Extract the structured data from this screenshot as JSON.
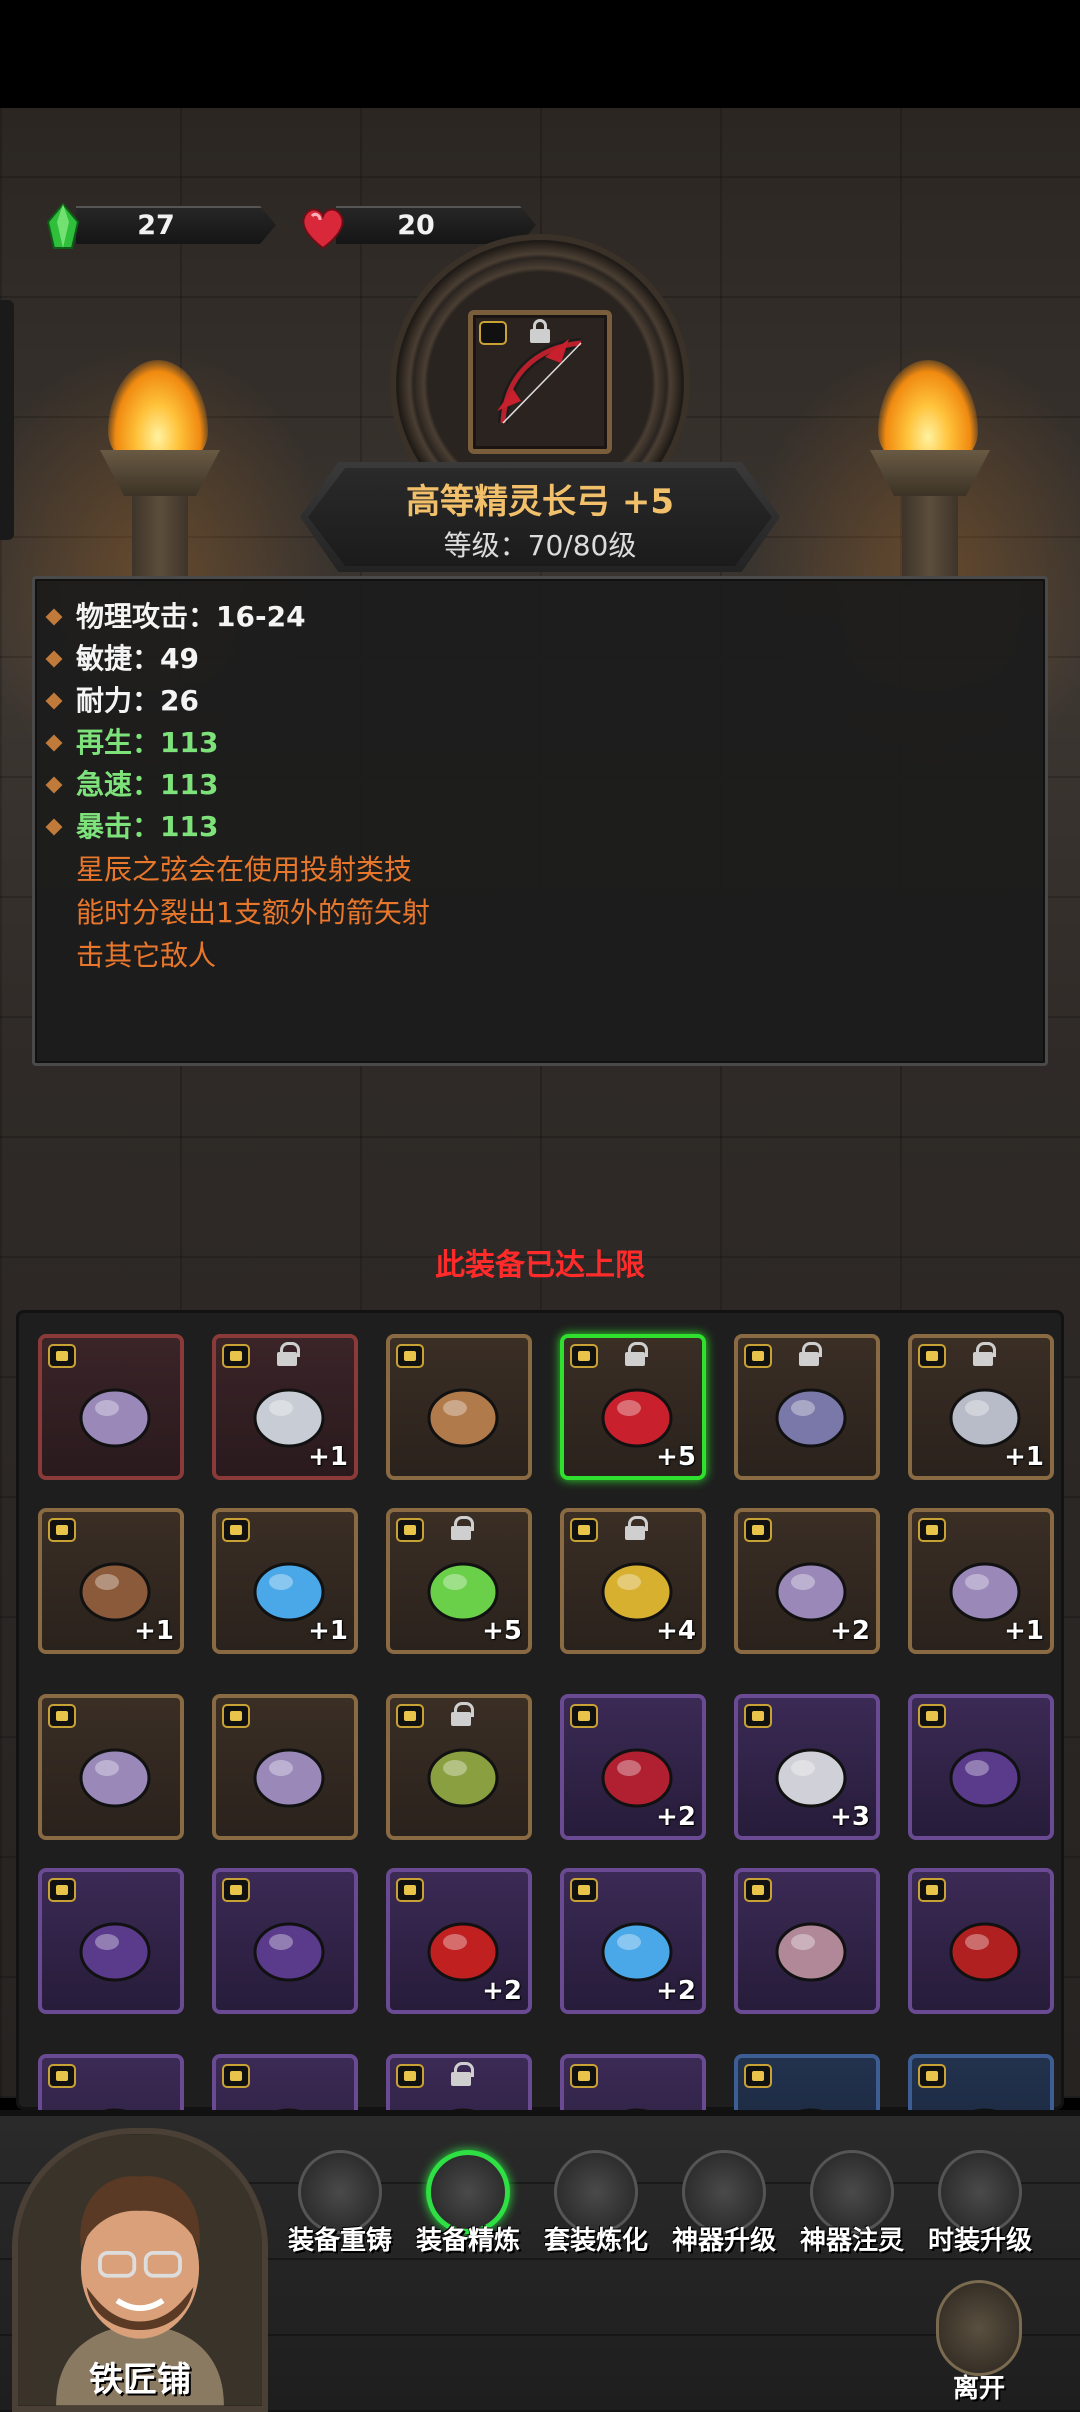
{
  "resources": [
    {
      "icon": "green-crystal-icon",
      "value": "27"
    },
    {
      "icon": "red-heart-gem-icon",
      "value": "20"
    }
  ],
  "item": {
    "name": "高等精灵长弓 +5",
    "level": "等级：70/80级",
    "icon": "elven-longbow-icon"
  },
  "stats": [
    {
      "text": "物理攻击：16-24",
      "color": "white"
    },
    {
      "text": "敏捷：49",
      "color": "white"
    },
    {
      "text": "耐力：26",
      "color": "white"
    },
    {
      "text": "再生：113",
      "color": "green"
    },
    {
      "text": "急速：113",
      "color": "green"
    },
    {
      "text": "暴击：113",
      "color": "green"
    }
  ],
  "description_lines": [
    "星辰之弦会在使用投射类技",
    "能时分裂出1支额外的箭矢射",
    "击其它敌人"
  ],
  "notice": "此装备已达上限",
  "inventory": [
    {
      "icon": "purple-shorts-icon",
      "frame": "red",
      "locked": false,
      "plus": ""
    },
    {
      "icon": "silver-greaves-icon",
      "frame": "red",
      "locked": true,
      "plus": "+1"
    },
    {
      "icon": "wooden-staff-icon",
      "frame": "bronze",
      "locked": false,
      "plus": ""
    },
    {
      "icon": "elven-longbow-icon",
      "frame": "selected",
      "locked": true,
      "plus": "+5"
    },
    {
      "icon": "war-hammer-icon",
      "frame": "bronze",
      "locked": true,
      "plus": ""
    },
    {
      "icon": "plate-armor-icon",
      "frame": "bronze",
      "locked": true,
      "plus": "+1"
    },
    {
      "icon": "feathered-hat-icon",
      "frame": "bronze",
      "locked": false,
      "plus": "+1"
    },
    {
      "icon": "blue-potion-necklace-icon",
      "frame": "bronze",
      "locked": false,
      "plus": "+1"
    },
    {
      "icon": "emerald-ring-icon",
      "frame": "bronze",
      "locked": true,
      "plus": "+5"
    },
    {
      "icon": "golden-eye-ring-icon",
      "frame": "bronze",
      "locked": true,
      "plus": "+4"
    },
    {
      "icon": "purple-shorts-icon",
      "frame": "bronze",
      "locked": false,
      "plus": "+2"
    },
    {
      "icon": "purple-boots-icon",
      "frame": "bronze",
      "locked": false,
      "plus": "+1"
    },
    {
      "icon": "purple-boots-icon",
      "frame": "bronze",
      "locked": false,
      "plus": ""
    },
    {
      "icon": "purple-boots-icon",
      "frame": "bronze",
      "locked": false,
      "plus": ""
    },
    {
      "icon": "green-boots-icon",
      "frame": "bronze",
      "locked": true,
      "plus": ""
    },
    {
      "icon": "red-coat-icon",
      "frame": "purple",
      "locked": false,
      "plus": "+2"
    },
    {
      "icon": "fur-armor-icon",
      "frame": "purple",
      "locked": false,
      "plus": "+3"
    },
    {
      "icon": "wizard-hat-icon",
      "frame": "purple",
      "locked": false,
      "plus": ""
    },
    {
      "icon": "wizard-hat-icon",
      "frame": "purple",
      "locked": false,
      "plus": ""
    },
    {
      "icon": "wizard-hat-icon",
      "frame": "purple",
      "locked": false,
      "plus": ""
    },
    {
      "icon": "plumed-helmet-icon",
      "frame": "purple",
      "locked": false,
      "plus": "+2"
    },
    {
      "icon": "blue-potion-necklace-icon",
      "frame": "purple",
      "locked": false,
      "plus": "+2"
    },
    {
      "icon": "pink-bracer-icon",
      "frame": "purple",
      "locked": false,
      "plus": ""
    },
    {
      "icon": "red-gauntlet-icon",
      "frame": "purple",
      "locked": false,
      "plus": ""
    },
    {
      "icon": "purple-helmet-icon",
      "frame": "purple",
      "locked": false,
      "plus": ""
    },
    {
      "icon": "butterfly-necklace-icon",
      "frame": "purple",
      "locked": false,
      "plus": ""
    },
    {
      "icon": "silver-helm-icon",
      "frame": "purple",
      "locked": true,
      "plus": ""
    },
    {
      "icon": "purple-cloth-icon",
      "frame": "purple",
      "locked": false,
      "plus": ""
    },
    {
      "icon": "silver-gauntlet-icon",
      "frame": "blue",
      "locked": false,
      "plus": ""
    },
    {
      "icon": "silver-gauntlet-icon",
      "frame": "blue",
      "locked": false,
      "plus": ""
    }
  ],
  "menu": [
    {
      "label": "装备重铸",
      "icon": "helmet-reforge-icon",
      "active": false
    },
    {
      "label": "装备精炼",
      "icon": "refine-icon",
      "active": true
    },
    {
      "label": "套装炼化",
      "icon": "set-smelt-icon",
      "active": false
    },
    {
      "label": "神器升级",
      "icon": "artifact-upgrade-icon",
      "active": false
    },
    {
      "label": "神器注灵",
      "icon": "artifact-infuse-icon",
      "active": false
    },
    {
      "label": "时装升级",
      "icon": "costume-upgrade-icon",
      "active": false
    }
  ],
  "npc": {
    "label": "铁匠铺",
    "icon": "blacksmith-portrait"
  },
  "leave": {
    "label": "离开",
    "icon": "exit-door-icon"
  }
}
